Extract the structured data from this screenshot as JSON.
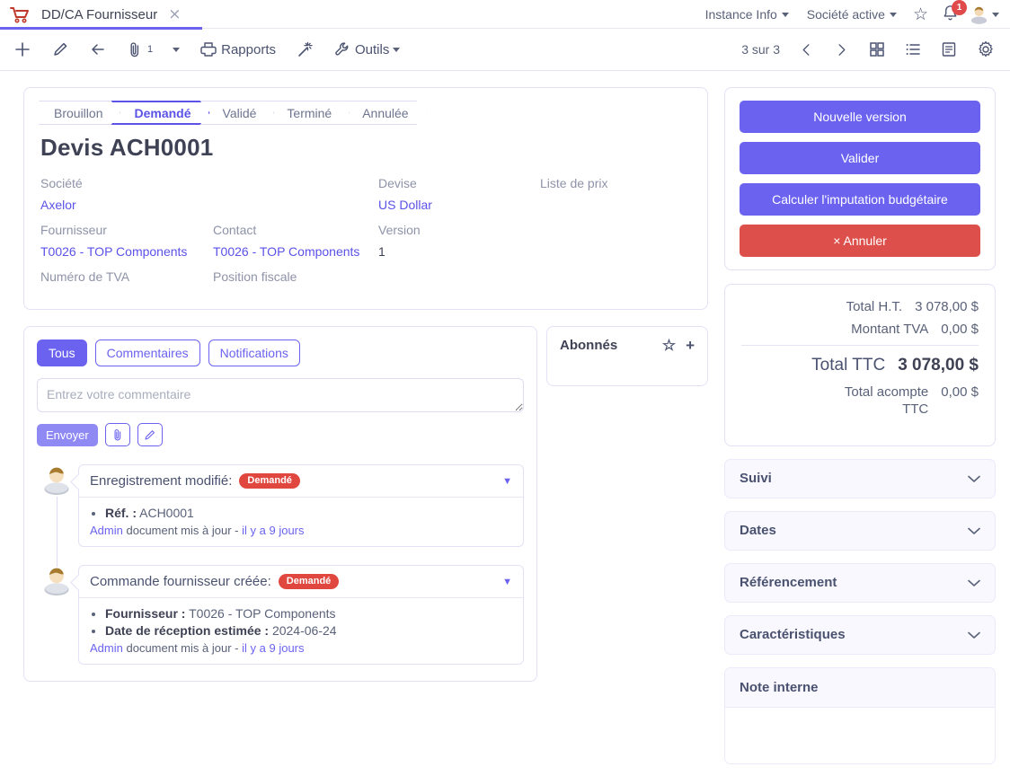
{
  "topbar": {
    "app_icon": "shopping-cart-icon",
    "tab_title": "DD/CA Fournisseur",
    "close": "×",
    "instance_info": "Instance Info",
    "active_company": "Société active",
    "favorite_icon": "star-icon",
    "notification_count": "1",
    "user_avatar": "user-avatar-icon"
  },
  "toolbar": {
    "new_icon": "plus-icon",
    "edit_icon": "pencil-icon",
    "back_icon": "arrow-left-icon",
    "attachment_icon": "paperclip-icon",
    "attachment_count": "1",
    "reports": "Rapports",
    "wand_icon": "magic-wand-icon",
    "tools": "Outils",
    "pager": "3 sur 3",
    "prev_icon": "chevron-left-icon",
    "next_icon": "chevron-right-icon",
    "grid_view_icon": "grid-view-icon",
    "list_view_icon": "list-view-icon",
    "form_view_icon": "form-view-icon",
    "settings_icon": "gear-icon"
  },
  "record": {
    "statuses": [
      {
        "label": "Brouillon",
        "active": false
      },
      {
        "label": "Demandé",
        "active": true
      },
      {
        "label": "Validé",
        "active": false
      },
      {
        "label": "Terminé",
        "active": false
      },
      {
        "label": "Annulée",
        "active": false
      }
    ],
    "title": "Devis ACH0001",
    "fields": {
      "societe_label": "Société",
      "societe_value": "Axelor",
      "devise_label": "Devise",
      "devise_value": "US Dollar",
      "liste_prix_label": "Liste de prix",
      "liste_prix_value": "",
      "fournisseur_label": "Fournisseur",
      "fournisseur_value": "T0026 - TOP Components",
      "contact_label": "Contact",
      "contact_value": "T0026 - TOP Components",
      "version_label": "Version",
      "version_value": "1",
      "tva_label": "Numéro de TVA",
      "tva_value": "",
      "position_fiscale_label": "Position fiscale",
      "position_fiscale_value": ""
    }
  },
  "comments": {
    "filters": [
      {
        "label": "Tous",
        "active": true
      },
      {
        "label": "Commentaires",
        "active": false
      },
      {
        "label": "Notifications",
        "active": false
      }
    ],
    "input_placeholder": "Entrez votre commentaire",
    "input_value": "",
    "send_label": "Envoyer",
    "attach_icon": "paperclip-icon",
    "edit_icon": "pencil-icon",
    "threads": [
      {
        "avatar": "user-avatar-icon",
        "title": "Enregistrement modifié:",
        "tag": "Demandé",
        "caret_icon": "chevron-down-icon",
        "items": [
          {
            "label": "Réf. :",
            "value": "ACH0001"
          }
        ],
        "meta_user": "Admin",
        "meta_action": "document mis à jour",
        "meta_sep": "-",
        "meta_time": "il y a 9 jours"
      },
      {
        "avatar": "user-avatar-icon",
        "title": "Commande fournisseur créée:",
        "tag": "Demandé",
        "caret_icon": "chevron-down-icon",
        "items": [
          {
            "label": "Fournisseur :",
            "value": "T0026 - TOP Components"
          },
          {
            "label": "Date de réception estimée :",
            "value": "2024-06-24"
          }
        ],
        "meta_user": "Admin",
        "meta_action": "document mis à jour",
        "meta_sep": "-",
        "meta_time": "il y a 9 jours"
      }
    ]
  },
  "followers": {
    "title": "Abonnés",
    "star_icon": "star-icon",
    "add_icon": "plus-icon"
  },
  "actions": {
    "new_version": "Nouvelle version",
    "validate": "Valider",
    "compute_budget": "Calculer l'imputation budgétaire",
    "cancel": "×  Annuler"
  },
  "totals": {
    "rows": [
      {
        "label": "Total H.T.",
        "value": "3 078,00 $",
        "big": false
      },
      {
        "label": "Montant TVA",
        "value": "0,00 $",
        "big": false
      }
    ],
    "total_ttc_label": "Total TTC",
    "total_ttc_value": "3 078,00 $",
    "deposit_label": "Total acompte TTC",
    "deposit_value": "0,00 $"
  },
  "panels": [
    {
      "title": "Suivi",
      "caret_icon": "chevron-down-icon"
    },
    {
      "title": "Dates",
      "caret_icon": "chevron-down-icon"
    },
    {
      "title": "Référencement",
      "caret_icon": "chevron-down-icon"
    },
    {
      "title": "Caractéristiques",
      "caret_icon": "chevron-down-icon"
    }
  ],
  "note": {
    "title": "Note interne",
    "value": ""
  },
  "colors": {
    "accent": "#6b63f0",
    "danger": "#dd4f4a",
    "tag": "#e0483f",
    "link": "#5b52e8",
    "muted": "#8e93a8"
  }
}
